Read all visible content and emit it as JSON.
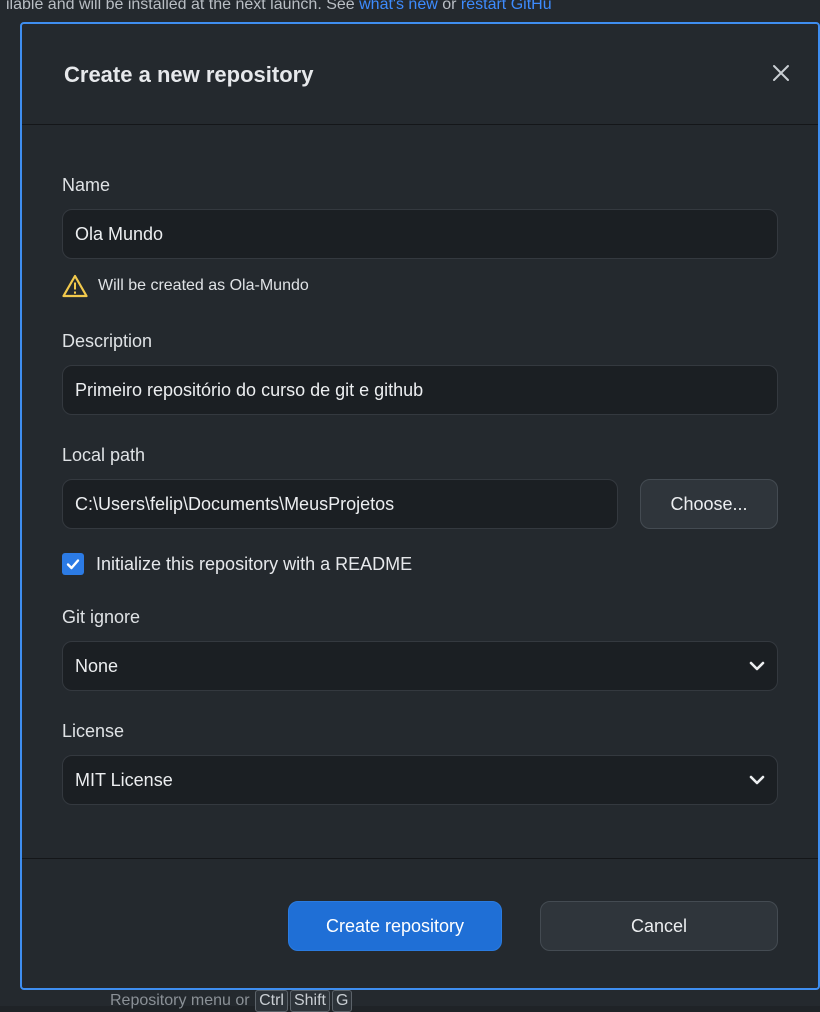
{
  "background": {
    "banner_text": "ilable and will be installed at the next launch. See ",
    "banner_link1": "what's new",
    "banner_or": " or ",
    "banner_link2": "restart GitHu",
    "bottom_text": "Repository menu or ",
    "bottom_keys": [
      "Ctrl",
      "Shift",
      "G"
    ]
  },
  "dialog": {
    "title": "Create a new repository",
    "close_icon": "close-icon",
    "name_label": "Name",
    "name_value": "Ola Mundo",
    "warning_text": "Will be created as Ola-Mundo",
    "description_label": "Description",
    "description_value": "Primeiro repositório do curso de git e github",
    "local_path_label": "Local path",
    "local_path_value": "C:\\Users\\felip\\Documents\\MeusProjetos",
    "choose_label": "Choose...",
    "readme_label": "Initialize this repository with a README",
    "readme_checked": true,
    "gitignore_label": "Git ignore",
    "gitignore_value": "None",
    "license_label": "License",
    "license_value": "MIT License",
    "create_label": "Create repository",
    "cancel_label": "Cancel"
  },
  "colors": {
    "accent": "#1f6fd6",
    "dialog_border": "#3f8ef0",
    "warning": "#f2c94c"
  }
}
